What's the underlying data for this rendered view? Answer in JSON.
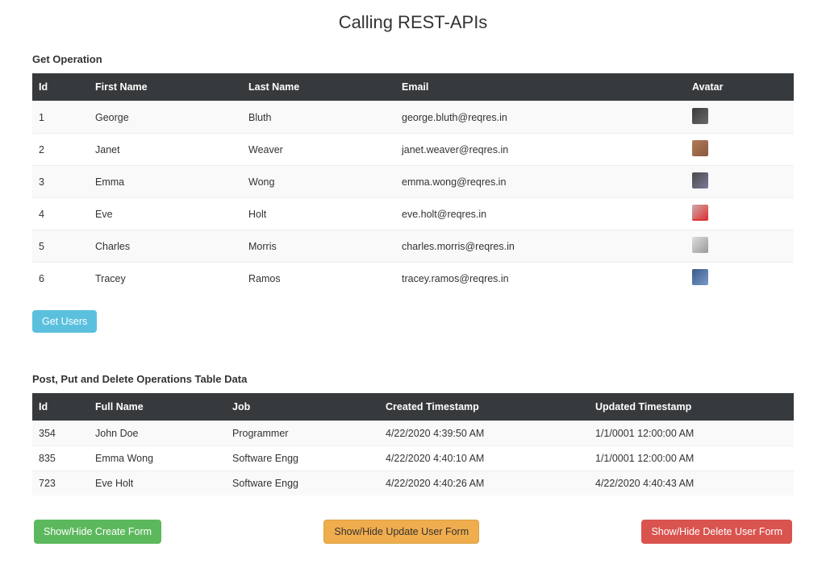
{
  "page": {
    "title": "Calling REST-APIs"
  },
  "section1": {
    "heading": "Get Operation",
    "headers": {
      "id": "Id",
      "first_name": "First Name",
      "last_name": "Last Name",
      "email": "Email",
      "avatar": "Avatar"
    },
    "rows": [
      {
        "id": "1",
        "first_name": "George",
        "last_name": "Bluth",
        "email": "george.bluth@reqres.in"
      },
      {
        "id": "2",
        "first_name": "Janet",
        "last_name": "Weaver",
        "email": "janet.weaver@reqres.in"
      },
      {
        "id": "3",
        "first_name": "Emma",
        "last_name": "Wong",
        "email": "emma.wong@reqres.in"
      },
      {
        "id": "4",
        "first_name": "Eve",
        "last_name": "Holt",
        "email": "eve.holt@reqres.in"
      },
      {
        "id": "5",
        "first_name": "Charles",
        "last_name": "Morris",
        "email": "charles.morris@reqres.in"
      },
      {
        "id": "6",
        "first_name": "Tracey",
        "last_name": "Ramos",
        "email": "tracey.ramos@reqres.in"
      }
    ],
    "get_users_label": "Get Users"
  },
  "section2": {
    "heading": "Post, Put and Delete Operations Table Data",
    "headers": {
      "id": "Id",
      "full_name": "Full Name",
      "job": "Job",
      "created": "Created Timestamp",
      "updated": "Updated Timestamp"
    },
    "rows": [
      {
        "id": "354",
        "full_name": "John Doe",
        "job": "Programmer",
        "created": "4/22/2020 4:39:50 AM",
        "updated": "1/1/0001 12:00:00 AM"
      },
      {
        "id": "835",
        "full_name": "Emma Wong",
        "job": "Software Engg",
        "created": "4/22/2020 4:40:10 AM",
        "updated": "1/1/0001 12:00:00 AM"
      },
      {
        "id": "723",
        "full_name": "Eve Holt",
        "job": "Software Engg",
        "created": "4/22/2020 4:40:26 AM",
        "updated": "4/22/2020 4:40:43 AM"
      }
    ]
  },
  "buttons": {
    "create": "Show/Hide Create Form",
    "update": "Show/Hide Update User Form",
    "delete": "Show/Hide Delete User Form"
  }
}
